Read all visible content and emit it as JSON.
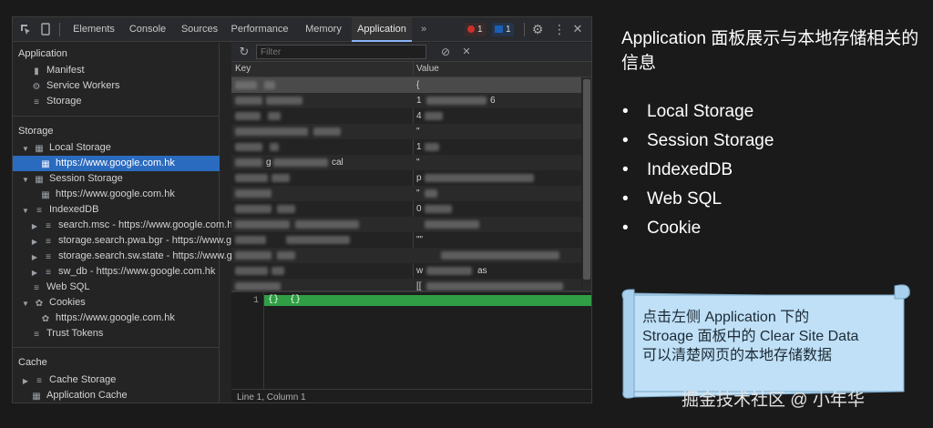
{
  "toolbar": {
    "tabs": [
      "Elements",
      "Console",
      "Sources",
      "Performance",
      "Memory",
      "Application"
    ],
    "more": "»",
    "error_count": "1",
    "message_count": "1"
  },
  "sidebar": {
    "application_header": "Application",
    "application_items": [
      "Manifest",
      "Service Workers",
      "Storage"
    ],
    "storage_header": "Storage",
    "local_storage": "Local Storage",
    "local_storage_origin": "https://www.google.com.hk",
    "session_storage": "Session Storage",
    "session_storage_origin": "https://www.google.com.hk",
    "indexeddb": "IndexedDB",
    "indexeddb_items": [
      "search.msc - https://www.google.com.h",
      "storage.search.pwa.bgr - https://www.g",
      "storage.search.sw.state - https://www.g",
      "sw_db - https://www.google.com.hk"
    ],
    "web_sql": "Web SQL",
    "cookies": "Cookies",
    "cookies_origin": "https://www.google.com.hk",
    "trust_tokens": "Trust Tokens",
    "cache_header": "Cache",
    "cache_storage": "Cache Storage",
    "application_cache": "Application Cache"
  },
  "main": {
    "filter_placeholder": "Filter",
    "col_key": "Key",
    "col_value": "Value",
    "row_fragments": {
      "r0v": "{",
      "r1v": "1",
      "r1v2": "6",
      "r2v": "4",
      "r3v": "\"",
      "r4v": "1",
      "r5k": "g",
      "r5k2": "cal",
      "r5v": "\"",
      "r6v": "p",
      "r7v": "\"",
      "r8v": "0",
      "r10v": "\"\"",
      "r12v": "w",
      "r12v2": "as",
      "r13v": "[["
    },
    "preview_line_number": "1",
    "preview_code": "{}  {}",
    "status": "Line 1, Column 1"
  },
  "slide": {
    "title": "Application 面板展示与本地存储相关的信息",
    "bullets": [
      "Local Storage",
      "Session Storage",
      "IndexedDB",
      "Web SQL",
      "Cookie"
    ],
    "bullet_symbol": "•",
    "note_lines": [
      "点击左侧 Application 下的",
      "Stroage 面板中的 Clear Site Data",
      "可以清楚网页的本地存储数据"
    ],
    "watermark": "掘金技术社区 @ 小年华"
  },
  "colors": {
    "selected": "#2b6bbf",
    "note_bg": "#bfe0f6",
    "preview_highlight": "#2f9e44",
    "error_badge": "#c9302c",
    "message_badge": "#1a5fb4"
  },
  "icons": [
    "inspect-icon",
    "device-toggle-icon",
    "settings-gear-icon",
    "kebab-menu-icon",
    "close-icon",
    "refresh-icon",
    "clear-icon",
    "database-icon",
    "cookie-icon",
    "grid-icon",
    "gear-icon",
    "file-icon"
  ]
}
